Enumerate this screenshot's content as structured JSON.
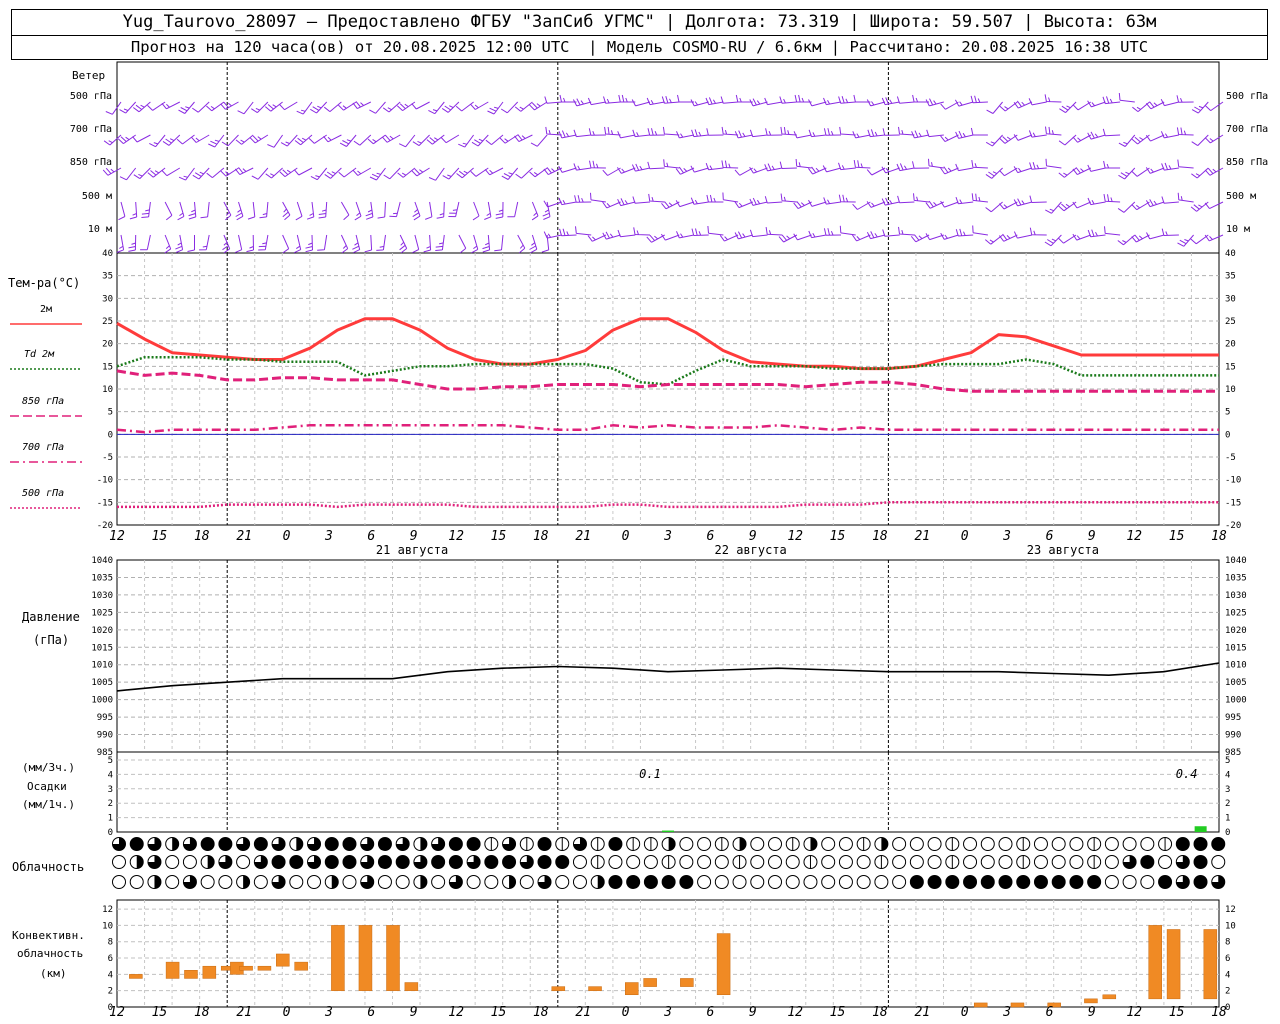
{
  "header": {
    "line1": "Yug_Taurovo_28097 – Предоставлено ФГБУ \"ЗапСиб УГМС\" | Долгота: 73.319 | Широта: 59.507 | Высота: 63м",
    "line2": "Прогноз на 120 часа(ов) от 20.08.2025 12:00 UTC  | Модель COSMO-RU / 6.6км | Рассчитано: 20.08.2025 16:38 UTC"
  },
  "time_axis": {
    "ticks": [
      "12",
      "15",
      "18",
      "21",
      "0",
      "3",
      "6",
      "9",
      "12",
      "15",
      "18",
      "21",
      "0",
      "3",
      "6",
      "9",
      "12",
      "15",
      "18",
      "21",
      "0",
      "3",
      "6",
      "9",
      "12",
      "15",
      "18"
    ],
    "day_labels": [
      "21 августа",
      "22 августа",
      "23 августа"
    ]
  },
  "wind_panel": {
    "title": "Ветер",
    "levels": [
      "500 гПа",
      "700 гПа",
      "850 гПа",
      "500 м",
      "10  м"
    ],
    "color": "#8a2be2"
  },
  "temp_panel": {
    "title": "Тем-ра(°С)",
    "legend": [
      {
        "label": "2м",
        "color": "#ff3b3b",
        "dash": "solid"
      },
      {
        "label": "Td  2м",
        "color": "#1a7a1a",
        "dash": "dot"
      },
      {
        "label": "850 гПа",
        "color": "#e0207a",
        "dash": "dash"
      },
      {
        "label": "700 гПа",
        "color": "#e0207a",
        "dash": "dashdot"
      },
      {
        "label": "500 гПа",
        "color": "#e0207a",
        "dash": "dotfine"
      }
    ],
    "y_ticks": [
      "40",
      "35",
      "30",
      "25",
      "20",
      "15",
      "10",
      "5",
      "0",
      "-5",
      "-10",
      "-15",
      "-20"
    ]
  },
  "pressure_panel": {
    "title1": "Давление",
    "title2": "(гПа)",
    "y_ticks": [
      "1040",
      "1035",
      "1030",
      "1025",
      "1020",
      "1015",
      "1010",
      "1005",
      "1000",
      "995",
      "990",
      "985"
    ]
  },
  "precip_panel": {
    "label1": "(мм/3ч.)",
    "label2": "Осадки",
    "label3": "(мм/1ч.)",
    "y_ticks": [
      "5",
      "4",
      "3",
      "2",
      "1",
      "0"
    ],
    "annotations": [
      "0.1",
      "0.4"
    ]
  },
  "cloud_panel": {
    "title": "Облачность"
  },
  "conv_panel": {
    "title1": "Конвективн.",
    "title2": "облачность",
    "title3": "(км)",
    "y_ticks": [
      "12",
      "10",
      "8",
      "6",
      "4",
      "2",
      "0"
    ],
    "color": "#f08a24"
  },
  "chart_data": [
    {
      "type": "line",
      "title": "Тем-ра(°С)",
      "x_hours": [
        0,
        3,
        6,
        9,
        12,
        15,
        18,
        21,
        24,
        27,
        30,
        33,
        36,
        39,
        42,
        45,
        48,
        51,
        54,
        57,
        60,
        63,
        66,
        69,
        72,
        75,
        78,
        81,
        84,
        87,
        90,
        93,
        96,
        99,
        102,
        105,
        108,
        111,
        114,
        117,
        120
      ],
      "ylim": [
        -20,
        40
      ],
      "series": [
        {
          "name": "2м",
          "values": [
            24.5,
            21,
            18,
            17.5,
            17,
            16.5,
            16.5,
            19,
            23,
            25.5,
            25.5,
            23,
            19,
            16.5,
            15.5,
            15.5,
            16.5,
            18.5,
            23,
            25.5,
            25.5,
            22.5,
            18.5,
            16,
            15.5,
            15,
            15,
            14.5,
            14.5,
            15,
            16.5,
            18,
            22,
            21.5,
            19.5,
            17.5,
            17.5,
            17.5,
            17.5,
            17.5,
            17.5
          ]
        },
        {
          "name": "Td  2м",
          "values": [
            15,
            17,
            17,
            17,
            16.5,
            16.5,
            16,
            16,
            16,
            13,
            14,
            15,
            15,
            15.5,
            15.5,
            15.5,
            15.5,
            15.5,
            14.5,
            11.5,
            11,
            14,
            16.5,
            15,
            15,
            15,
            14.5,
            14.5,
            14.5,
            15,
            15.5,
            15.5,
            15.5,
            16.5,
            15.5,
            13,
            13,
            13,
            13,
            13,
            13
          ]
        },
        {
          "name": "850 гПа",
          "values": [
            14,
            13,
            13.5,
            13,
            12,
            12,
            12.5,
            12.5,
            12,
            12,
            12,
            11,
            10,
            10,
            10.5,
            10.5,
            11,
            11,
            11,
            10.5,
            11,
            11,
            11,
            11,
            11,
            10.5,
            11,
            11.5,
            11.5,
            11,
            10,
            9.5,
            9.5,
            9.5,
            9.5,
            9.5,
            9.5,
            9.5,
            9.5,
            9.5,
            9.5
          ]
        },
        {
          "name": "700 гПа",
          "values": [
            1,
            0.5,
            1,
            1,
            1,
            1,
            1.5,
            2,
            2,
            2,
            2,
            2,
            2,
            2,
            2,
            1.5,
            1,
            1,
            2,
            1.5,
            2,
            1.5,
            1.5,
            1.5,
            2,
            1.5,
            1,
            1.5,
            1,
            1,
            1,
            1,
            1,
            1,
            1,
            1,
            1,
            1,
            1,
            1,
            1
          ]
        },
        {
          "name": "500 гПа",
          "values": [
            -16,
            -16,
            -16,
            -16,
            -15.5,
            -15.5,
            -15.5,
            -15.5,
            -16,
            -15.5,
            -15.5,
            -15.5,
            -15.5,
            -16,
            -16,
            -16,
            -16,
            -16,
            -15.5,
            -15.5,
            -16,
            -16,
            -16,
            -16,
            -16,
            -15.5,
            -15.5,
            -15.5,
            -15,
            -15,
            -15,
            -15,
            -15,
            -15,
            -15,
            -15,
            -15,
            -15,
            -15,
            -15,
            -15
          ]
        }
      ]
    },
    {
      "type": "line",
      "title": "Давление",
      "x_hours": [
        0,
        6,
        12,
        18,
        24,
        30,
        36,
        42,
        48,
        54,
        60,
        66,
        72,
        78,
        84,
        90,
        96,
        102,
        108,
        114,
        120
      ],
      "ylim": [
        985,
        1040
      ],
      "series": [
        {
          "name": "Давление",
          "values": [
            1002.5,
            1004,
            1005,
            1006,
            1006,
            1006,
            1008,
            1009,
            1009.5,
            1009,
            1008,
            1008.5,
            1009,
            1008.5,
            1008,
            1008,
            1008,
            1007.5,
            1007,
            1008,
            1010.5
          ]
        }
      ]
    },
    {
      "type": "bar",
      "title": "Осадки",
      "x_hours": [
        60,
        118
      ],
      "values": [
        0.1,
        0.4
      ],
      "ylim": [
        0,
        5
      ]
    },
    {
      "type": "bar",
      "title": "Конвективн. облачность",
      "ylim": [
        0,
        13
      ],
      "bars": [
        {
          "h": 2,
          "lo": 3.5,
          "hi": 4
        },
        {
          "h": 6,
          "lo": 3.5,
          "hi": 5.5
        },
        {
          "h": 8,
          "lo": 3.5,
          "hi": 4.5
        },
        {
          "h": 10,
          "lo": 3.5,
          "hi": 5
        },
        {
          "h": 12,
          "lo": 4.5,
          "hi": 5
        },
        {
          "h": 13,
          "lo": 4,
          "hi": 5.5
        },
        {
          "h": 14,
          "lo": 4.5,
          "hi": 5
        },
        {
          "h": 16,
          "lo": 4.5,
          "hi": 5
        },
        {
          "h": 18,
          "lo": 5,
          "hi": 6.5
        },
        {
          "h": 20,
          "lo": 4.5,
          "hi": 5.5
        },
        {
          "h": 24,
          "lo": 2,
          "hi": 10
        },
        {
          "h": 27,
          "lo": 2,
          "hi": 10
        },
        {
          "h": 30,
          "lo": 2,
          "hi": 10
        },
        {
          "h": 32,
          "lo": 2,
          "hi": 3
        },
        {
          "h": 48,
          "lo": 2,
          "hi": 2.5
        },
        {
          "h": 52,
          "lo": 2,
          "hi": 2.5
        },
        {
          "h": 56,
          "lo": 1.5,
          "hi": 3
        },
        {
          "h": 58,
          "lo": 2.5,
          "hi": 3.5
        },
        {
          "h": 62,
          "lo": 2.5,
          "hi": 3.5
        },
        {
          "h": 66,
          "lo": 1.5,
          "hi": 9
        },
        {
          "h": 94,
          "lo": 0,
          "hi": 0.5
        },
        {
          "h": 98,
          "lo": 0,
          "hi": 0.5
        },
        {
          "h": 102,
          "lo": 0,
          "hi": 0.5
        },
        {
          "h": 106,
          "lo": 0.5,
          "hi": 1
        },
        {
          "h": 108,
          "lo": 1,
          "hi": 1.5
        },
        {
          "h": 113,
          "lo": 1,
          "hi": 10
        },
        {
          "h": 115,
          "lo": 1,
          "hi": 9.5
        },
        {
          "h": 119,
          "lo": 1,
          "hi": 9.5
        }
      ]
    }
  ]
}
